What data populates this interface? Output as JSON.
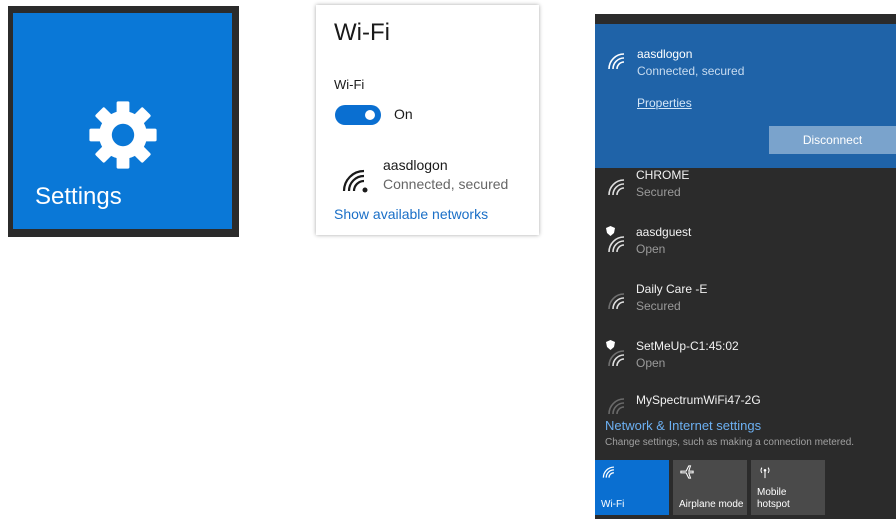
{
  "settings_tile": {
    "label": "Settings",
    "color": "#0a78d7"
  },
  "wifi_settings": {
    "title": "Wi-Fi",
    "toggle_label": "Wi-Fi",
    "toggle_state": "On",
    "network": {
      "name": "aasdlogon",
      "status": "Connected, secured"
    },
    "show_networks_link": "Show available networks"
  },
  "flyout": {
    "connected": {
      "name": "aasdlogon",
      "status": "Connected, secured",
      "properties_link": "Properties",
      "disconnect_label": "Disconnect"
    },
    "networks": [
      {
        "name": "CHROME",
        "status": "Secured",
        "icon": "wifi-icon"
      },
      {
        "name": "aasdguest",
        "status": "Open",
        "icon": "wifi-open-shield-icon"
      },
      {
        "name": "Daily Care -E",
        "status": "Secured",
        "icon": "wifi-icon"
      },
      {
        "name": "SetMeUp-C1:45:02",
        "status": "Open",
        "icon": "wifi-open-shield-icon"
      },
      {
        "name": "MySpectrumWiFi47-2G",
        "status": "",
        "icon": "wifi-weak-icon"
      }
    ],
    "settings_link": "Network & Internet settings",
    "settings_desc": "Change settings, such as making a connection metered.",
    "quick_actions": [
      {
        "label": "Wi-Fi",
        "icon": "wifi-icon",
        "active": true
      },
      {
        "label": "Airplane mode",
        "icon": "airplane-icon",
        "active": false
      },
      {
        "label": "Mobile hotspot",
        "icon": "hotspot-icon",
        "active": false
      }
    ]
  }
}
